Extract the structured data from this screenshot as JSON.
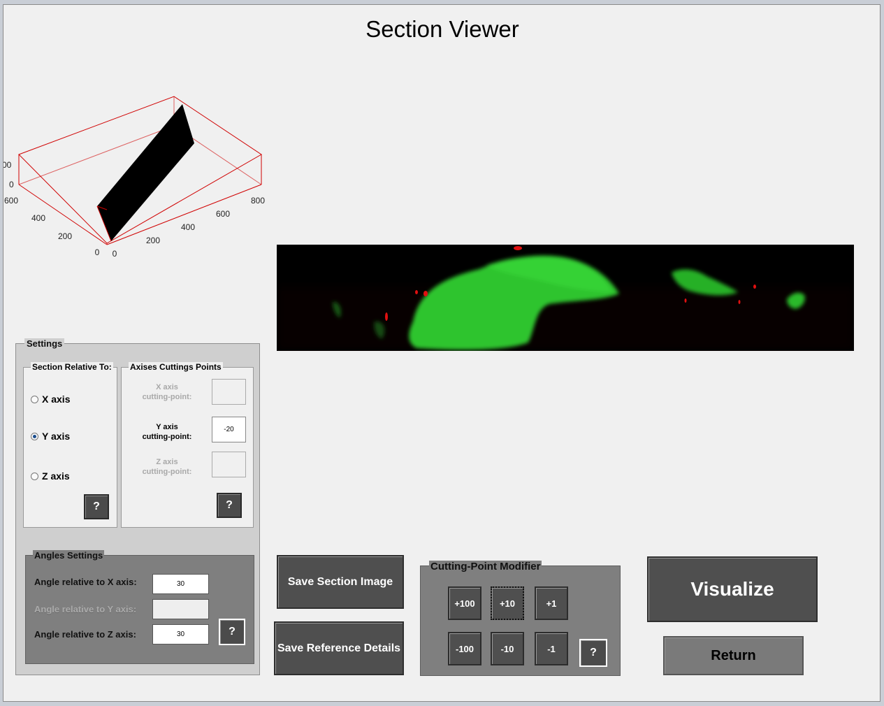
{
  "window": {
    "title": "Section Viewer"
  },
  "plot": {
    "x_ticks": [
      "0",
      "200",
      "400",
      "600",
      "800"
    ],
    "y_ticks": [
      "0",
      "200",
      "400",
      "600"
    ],
    "z_ticks": [
      "0",
      "00"
    ]
  },
  "settings": {
    "title": "Settings",
    "section_relative": {
      "title": "Section Relative To:",
      "options": [
        {
          "label": "X axis",
          "selected": false
        },
        {
          "label": "Y axis",
          "selected": true
        },
        {
          "label": "Z axis",
          "selected": false
        }
      ],
      "help_label": "?"
    },
    "cutting_points": {
      "title": "Axises Cuttings Points",
      "x": {
        "label_line1": "X axis",
        "label_line2": "cutting-point:",
        "value": "",
        "enabled": false
      },
      "y": {
        "label_line1": "Y axis",
        "label_line2": "cutting-point:",
        "value": "-20",
        "enabled": true
      },
      "z": {
        "label_line1": "Z axis",
        "label_line2": "cutting-point:",
        "value": "",
        "enabled": false
      },
      "help_label": "?"
    },
    "angles": {
      "title": "Angles Settings",
      "x": {
        "label": "Angle relative to X axis:",
        "value": "30",
        "enabled": true
      },
      "y": {
        "label": "Angle relative to Y axis:",
        "value": "",
        "enabled": false
      },
      "z": {
        "label": "Angle relative to Z axis:",
        "value": "30",
        "enabled": true
      },
      "help_label": "?"
    }
  },
  "actions": {
    "save_section_image": "Save Section Image",
    "save_reference_details": "Save Reference Details",
    "visualize": "Visualize",
    "return": "Return"
  },
  "modifier": {
    "title": "Cutting-Point Modifier",
    "buttons": [
      "+100",
      "+10",
      "+1",
      "-100",
      "-10",
      "-1"
    ],
    "help_label": "?"
  },
  "colors": {
    "window_bg": "#f0f0f0",
    "button_dark": "#4f4f4f",
    "panel_gray": "#7f7f7f",
    "plot_edges": "#d00000",
    "section_green": "#2fd12f",
    "section_red": "#e01010"
  }
}
